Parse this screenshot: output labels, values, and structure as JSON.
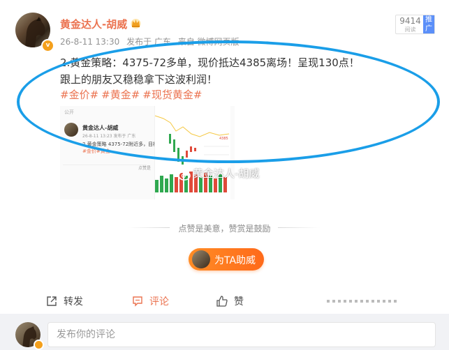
{
  "post": {
    "username": "黄金达人-胡威",
    "meta": {
      "time": "26-8-11 13:30",
      "location": "发布于 广东",
      "source": "来自 微博网页版"
    },
    "read": {
      "count": "9414",
      "label": "阅读",
      "promote": "推广"
    },
    "content_lines": [
      "2.黄金策略：4375-72多单，现价抵达4385离场！呈现130点！",
      "跟上的朋友又稳稳拿下这波利润！"
    ],
    "tags": [
      "#金价#",
      "#黄金#",
      "#现货黄金#"
    ],
    "image": {
      "watermark_text": "黄金达人-胡威",
      "thumb_pub_label": "公开",
      "thumb_name": "黄金达人-胡威",
      "thumb_meta": "26-8-11 13:23 发布于 广东",
      "thumb_text": "2.黄金策略 4375-72附近多，目标",
      "thumb_tags": "#金价#黄金",
      "thumb_like": "点赞是",
      "chart_price": "4385"
    }
  },
  "like_hint": {
    "sep": "···",
    "text": "点赞是美意，赞赏是鼓励"
  },
  "help_button": {
    "label": "为TA助威"
  },
  "actions": {
    "repost": "转发",
    "comment": "评论",
    "like": "赞"
  },
  "comment_box": {
    "placeholder": "发布你的评论"
  },
  "colors": {
    "accent_orange": "#eb7350",
    "highlight_circle": "#1a9ee8",
    "badge_gold": "#f4a01c"
  },
  "icons": [
    "crown-icon",
    "verified-badge-icon",
    "repost-icon",
    "comment-icon",
    "like-icon",
    "weibo-watermark-icon"
  ]
}
